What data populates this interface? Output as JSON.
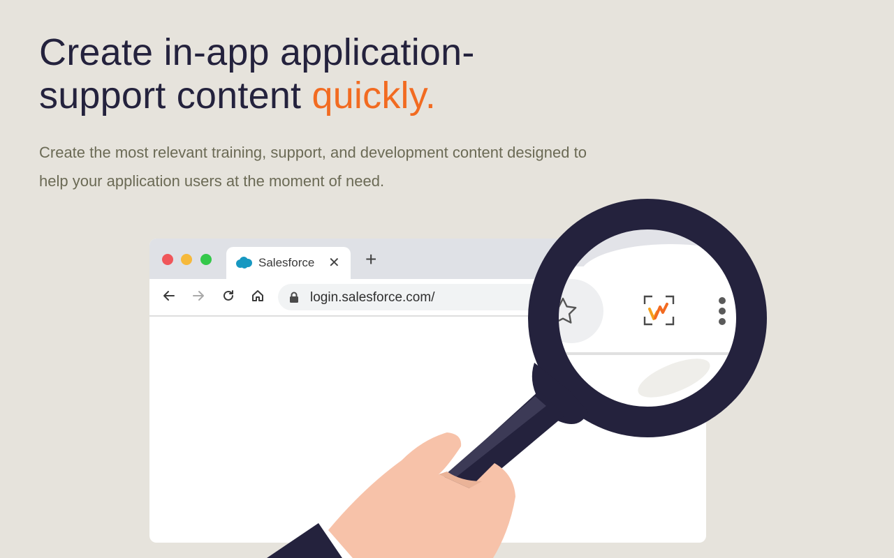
{
  "hero": {
    "headline_main": "Create in-app application-support content ",
    "headline_accent": "quickly.",
    "subtitle": "Create the most relevant training, support, and development content designed to help your application users at the moment of need."
  },
  "browser": {
    "tab": {
      "label": "Salesforce",
      "close_glyph": "✕",
      "icon": "salesforce-cloud-icon"
    },
    "new_tab_glyph": "+",
    "toolbar": {
      "back_icon": "arrow-left-icon",
      "forward_icon": "arrow-right-icon",
      "reload_icon": "reload-icon",
      "home_icon": "home-icon"
    },
    "address": {
      "url": "login.salesforce.com/",
      "icon": "lock-icon"
    },
    "magnified_toolbar": {
      "icons": [
        "star-icon",
        "extension-logo-icon",
        "kebab-menu-icon"
      ]
    }
  },
  "colors": {
    "background": "#e6e3dc",
    "headline": "#24223d",
    "accent": "#f26b21",
    "subtitle": "#6b6a55",
    "magnifier": "#24223d",
    "hand": "#f7c2a9"
  }
}
